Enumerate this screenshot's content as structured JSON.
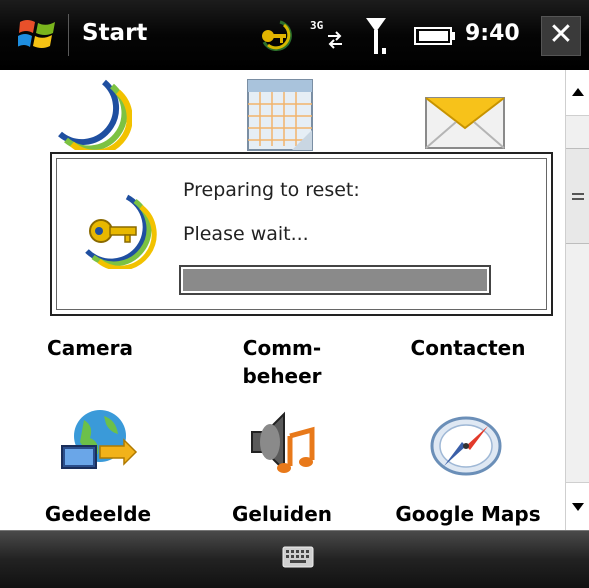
{
  "status_bar": {
    "title": "Start",
    "time": "9:40",
    "close_label": "✕",
    "icons": [
      "windows-start-icon",
      "activesync-icon",
      "3g-data-icon",
      "signal-strength-icon",
      "battery-icon"
    ]
  },
  "apps": {
    "row1": [
      {
        "name": "activesync-app-icon",
        "label": ""
      },
      {
        "name": "calendar-app-icon",
        "label": ""
      },
      {
        "name": "messaging-app-icon",
        "label": ""
      }
    ],
    "row2": [
      {
        "name": "camera-app",
        "label": "Camera"
      },
      {
        "name": "comm-beheer-app",
        "label_line1": "Comm-",
        "label_line2": "beheer"
      },
      {
        "name": "contacten-app",
        "label": "Contacten"
      }
    ],
    "row3": [
      {
        "name": "gedeelde-app",
        "icon": "network-share-icon",
        "label": "Gedeelde"
      },
      {
        "name": "geluiden-app",
        "icon": "speaker-music-icon",
        "label": "Geluiden"
      },
      {
        "name": "google-maps-app",
        "icon": "compass-icon",
        "label": "Google Maps"
      }
    ]
  },
  "dialog": {
    "title": "Preparing to reset:",
    "message": "Please wait...",
    "icon": "reset-key-icon",
    "progress": 1.0
  },
  "bottom_bar": {
    "icon": "keyboard-icon"
  },
  "colors": {
    "titlebar": "#000000",
    "progress_fill": "#8a8a8a",
    "bottombar": "#2b2b2b"
  }
}
